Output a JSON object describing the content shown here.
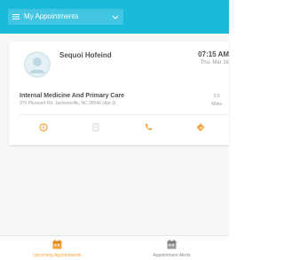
{
  "app_bar": {
    "title": "My Appointments",
    "color": "#18b9d9"
  },
  "appointment": {
    "patient_name": "Sequoi Hofeind",
    "time": "07:15 AM",
    "date": "Thu, Mar 16",
    "facility_name": "Internal Medicine And Primary Care",
    "facility_address": "975 Pleasant Rd, Jacksonville, NC 28546 (Apt 3)",
    "distance_value": "0.0",
    "distance_unit": "Miles",
    "actions": [
      "info-icon",
      "document-icon",
      "phone-icon",
      "directions-icon"
    ]
  },
  "bottom_nav": {
    "tabs": [
      {
        "label": "Upcoming Appointments",
        "icon": "calendar-icon",
        "selected": true
      },
      {
        "label": "Appointment Alerts",
        "icon": "calendar-alert-icon",
        "selected": false
      }
    ],
    "accent": "#f5a33c",
    "inactive": "#8a8a8a"
  }
}
